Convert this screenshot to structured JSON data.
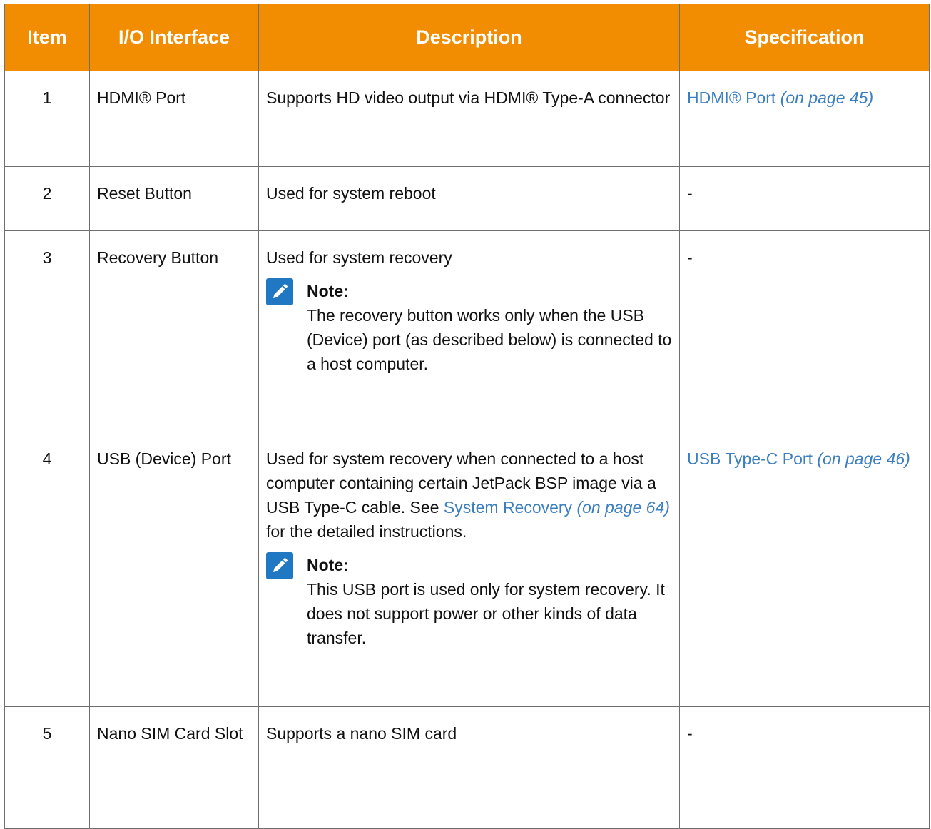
{
  "headers": {
    "item": "Item",
    "io_interface": "I/O Interface",
    "description": "Description",
    "specification": "Specification"
  },
  "rows": [
    {
      "item": "1",
      "io_interface": "HDMI® Port",
      "description": "Supports HD video output via HDMI® Type-A connector",
      "spec_link": "HDMI® Port",
      "spec_page": "(on page 45)"
    },
    {
      "item": "2",
      "io_interface": "Reset Button",
      "description": "Used for system reboot",
      "spec": "-"
    },
    {
      "item": "3",
      "io_interface": "Recovery Button",
      "description": "Used for system recovery",
      "note_title": "Note:",
      "note_text": "The recovery button works only when the USB (Device) port (as described below) is connected to a host computer.",
      "spec": "-"
    },
    {
      "item": "4",
      "io_interface": "USB (Device) Port",
      "description_prefix": "Used for system recovery when connected to a host computer containing certain JetPack BSP image via a USB Type-C cable. See",
      "description_link": "System Recovery",
      "description_page": "(on page 64)",
      "description_suffix": "for the detailed instructions.",
      "note_title": "Note:",
      "note_text": "This USB port is used only for system recovery. It does not support power or other kinds of data transfer.",
      "spec_link": "USB Type-C Port",
      "spec_page": "(on page 46)"
    },
    {
      "item": "5",
      "io_interface": "Nano SIM Card Slot",
      "description": "Supports a nano SIM card",
      "spec": "-"
    }
  ],
  "colors": {
    "header_bg": "#f28c00",
    "link": "#3c7fc1",
    "note_icon_bg": "#1f78c1"
  },
  "icons": {
    "note": "pencil-note-icon"
  }
}
